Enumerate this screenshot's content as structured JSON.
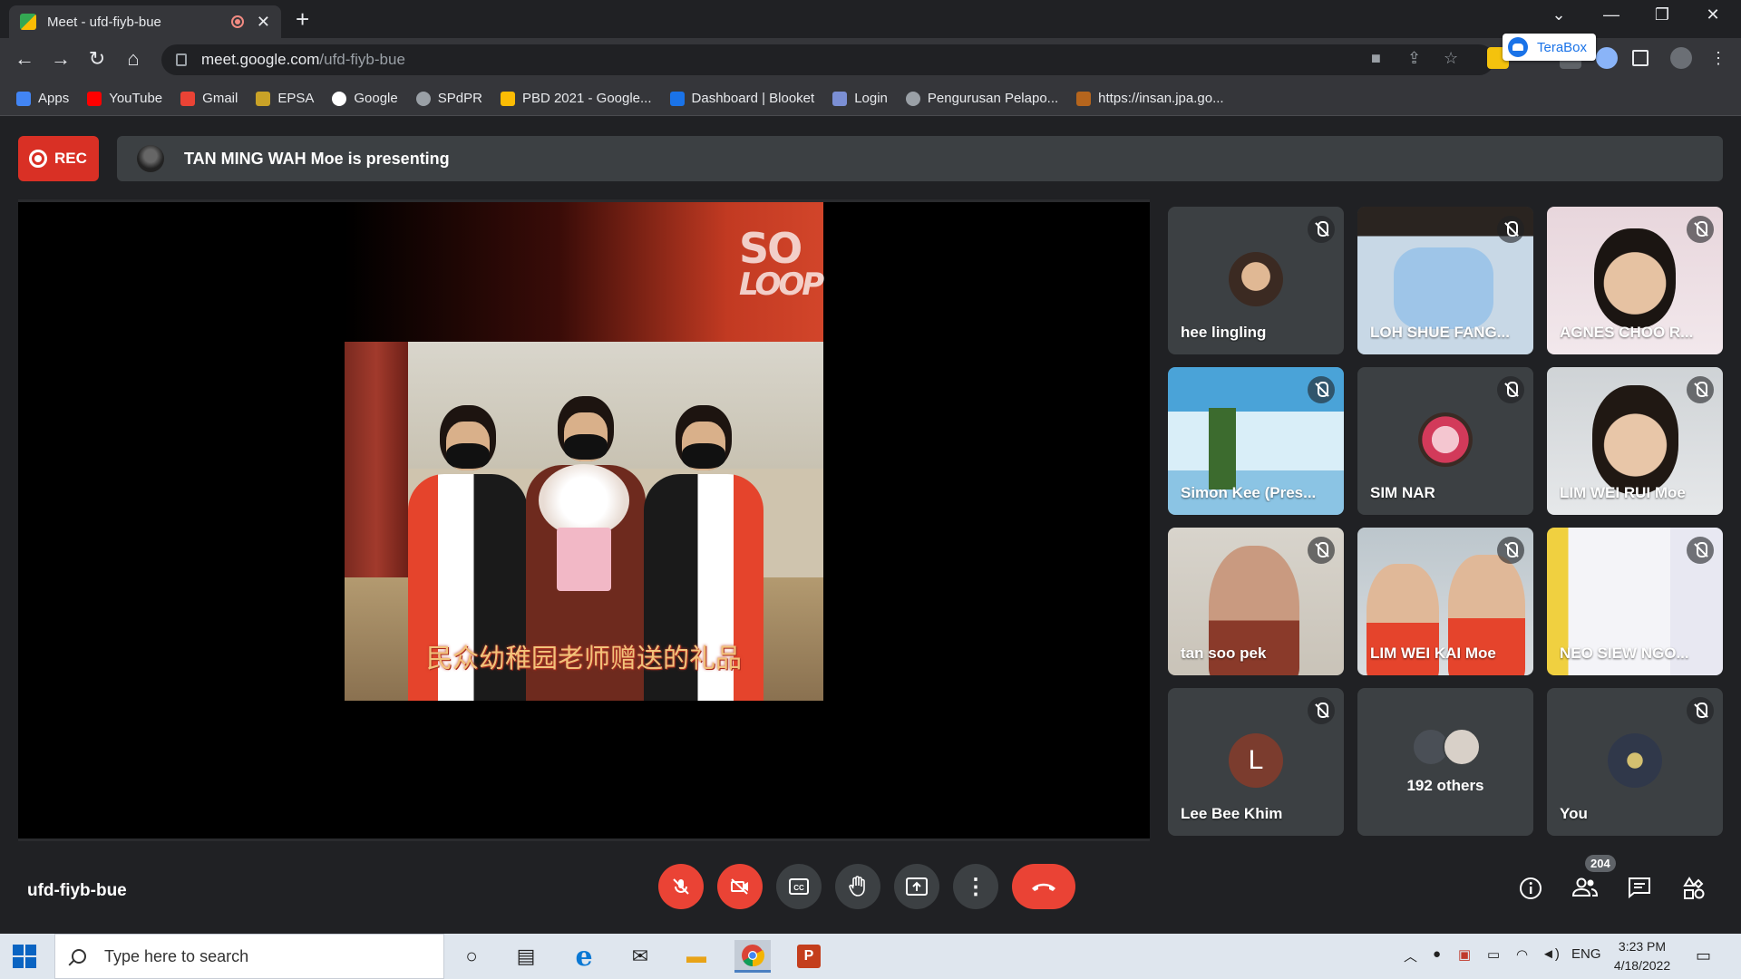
{
  "browser": {
    "tab_title": "Meet - ufd-fiyb-bue",
    "tab_close": "✕",
    "new_tab": "+",
    "url_host": "meet.google.com",
    "url_path": "/ufd-fiyb-bue",
    "extension_popup": "TeraBox",
    "window_controls": {
      "minimize": "—",
      "maximize": "❐",
      "close": "✕",
      "dropdown": "⌄"
    }
  },
  "bookmarks": [
    {
      "label": "Apps",
      "color": "#4285f4"
    },
    {
      "label": "YouTube",
      "color": "#ff0000"
    },
    {
      "label": "Gmail",
      "color": "#ea4335"
    },
    {
      "label": "EPSA",
      "color": "#c9a227"
    },
    {
      "label": "Google",
      "color": "#ffffff"
    },
    {
      "label": "SPdPR",
      "color": "#9aa0a6"
    },
    {
      "label": "PBD 2021 - Google...",
      "color": "#fbbc04"
    },
    {
      "label": "Dashboard | Blooket",
      "color": "#1a73e8"
    },
    {
      "label": "Login",
      "color": "#7b8fd4"
    },
    {
      "label": "Pengurusan Pelapo...",
      "color": "#9aa0a6"
    },
    {
      "label": "https://insan.jpa.go...",
      "color": "#b5651d"
    }
  ],
  "meet": {
    "rec_label": "REC",
    "presenting_text": "TAN MING WAH Moe is presenting",
    "slide_caption": "民众幼稚园老师赠送的礼品",
    "slide_logo_line1": "SO",
    "slide_logo_line2": "LOOP",
    "meeting_code": "ufd-fiyb-bue",
    "participant_count": "204",
    "participants": [
      {
        "name": "hee lingling"
      },
      {
        "name": "LOH SHUE FANG..."
      },
      {
        "name": "AGNES CHOO R..."
      },
      {
        "name": "Simon Kee (Pres..."
      },
      {
        "name": "SIM NAR"
      },
      {
        "name": "LIM WEI RUI Moe"
      },
      {
        "name": "tan soo pek"
      },
      {
        "name": "LIM WEI KAI Moe"
      },
      {
        "name": "NEO SIEW NGO..."
      },
      {
        "name": "Lee Bee Khim",
        "initial": "L"
      },
      {
        "name": "192 others"
      },
      {
        "name": "You"
      }
    ]
  },
  "taskbar": {
    "search_placeholder": "Type here to search",
    "language": "ENG",
    "time": "3:23 PM",
    "date": "4/18/2022"
  }
}
